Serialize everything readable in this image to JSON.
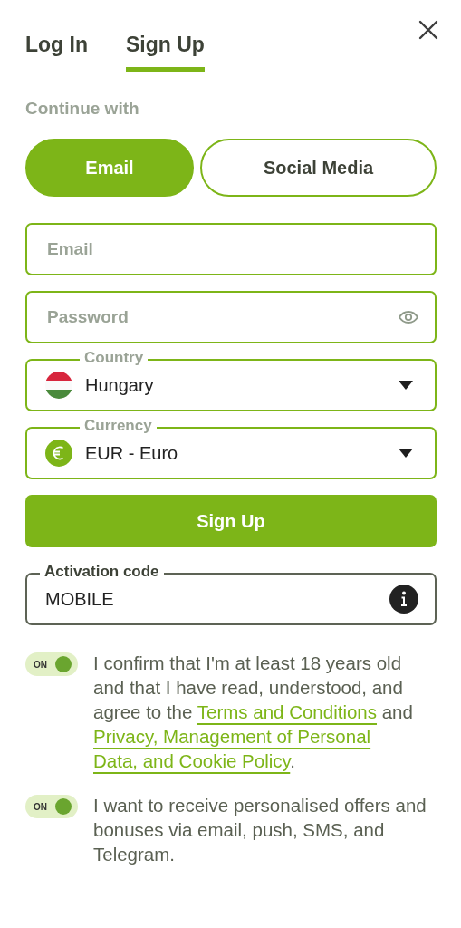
{
  "tabs": [
    {
      "label": "Log In",
      "selected": false
    },
    {
      "label": "Sign Up",
      "selected": true
    }
  ],
  "continue_label": "Continue with",
  "methods": [
    {
      "label": "Email",
      "selected": true
    },
    {
      "label": "Social Media",
      "selected": false
    }
  ],
  "fields": [
    {
      "kind": "text",
      "placeholder": "Email"
    },
    {
      "kind": "password",
      "placeholder": "Password"
    },
    {
      "kind": "select",
      "label": "Country",
      "value": "Hungary"
    },
    {
      "kind": "select",
      "label": "Currency",
      "value": "EUR - Euro"
    }
  ],
  "submit": "Sign Up",
  "activation": {
    "label": "Activation code",
    "value": "MOBILE"
  },
  "consents": [
    {
      "on": true,
      "toggle_text": "ON",
      "segments": [
        {
          "text": "I confirm that I'm at least 18 years old and that I have read, understood, and agree to the ",
          "kind": "text"
        },
        {
          "text": "Terms and Conditions",
          "kind": "link"
        },
        {
          "text": " and ",
          "kind": "text"
        },
        {
          "text": "Privacy, Management of Personal",
          "kind": "link"
        },
        {
          "text": "Data, and Cookie Policy",
          "kind": "link"
        },
        {
          "text": ".",
          "kind": "text"
        }
      ]
    },
    {
      "on": true,
      "toggle_text": "ON",
      "segments": [
        {
          "text": "I want to receive personalised offers and bonuses via email, push, SMS, and Telegram.",
          "kind": "text"
        }
      ]
    }
  ]
}
